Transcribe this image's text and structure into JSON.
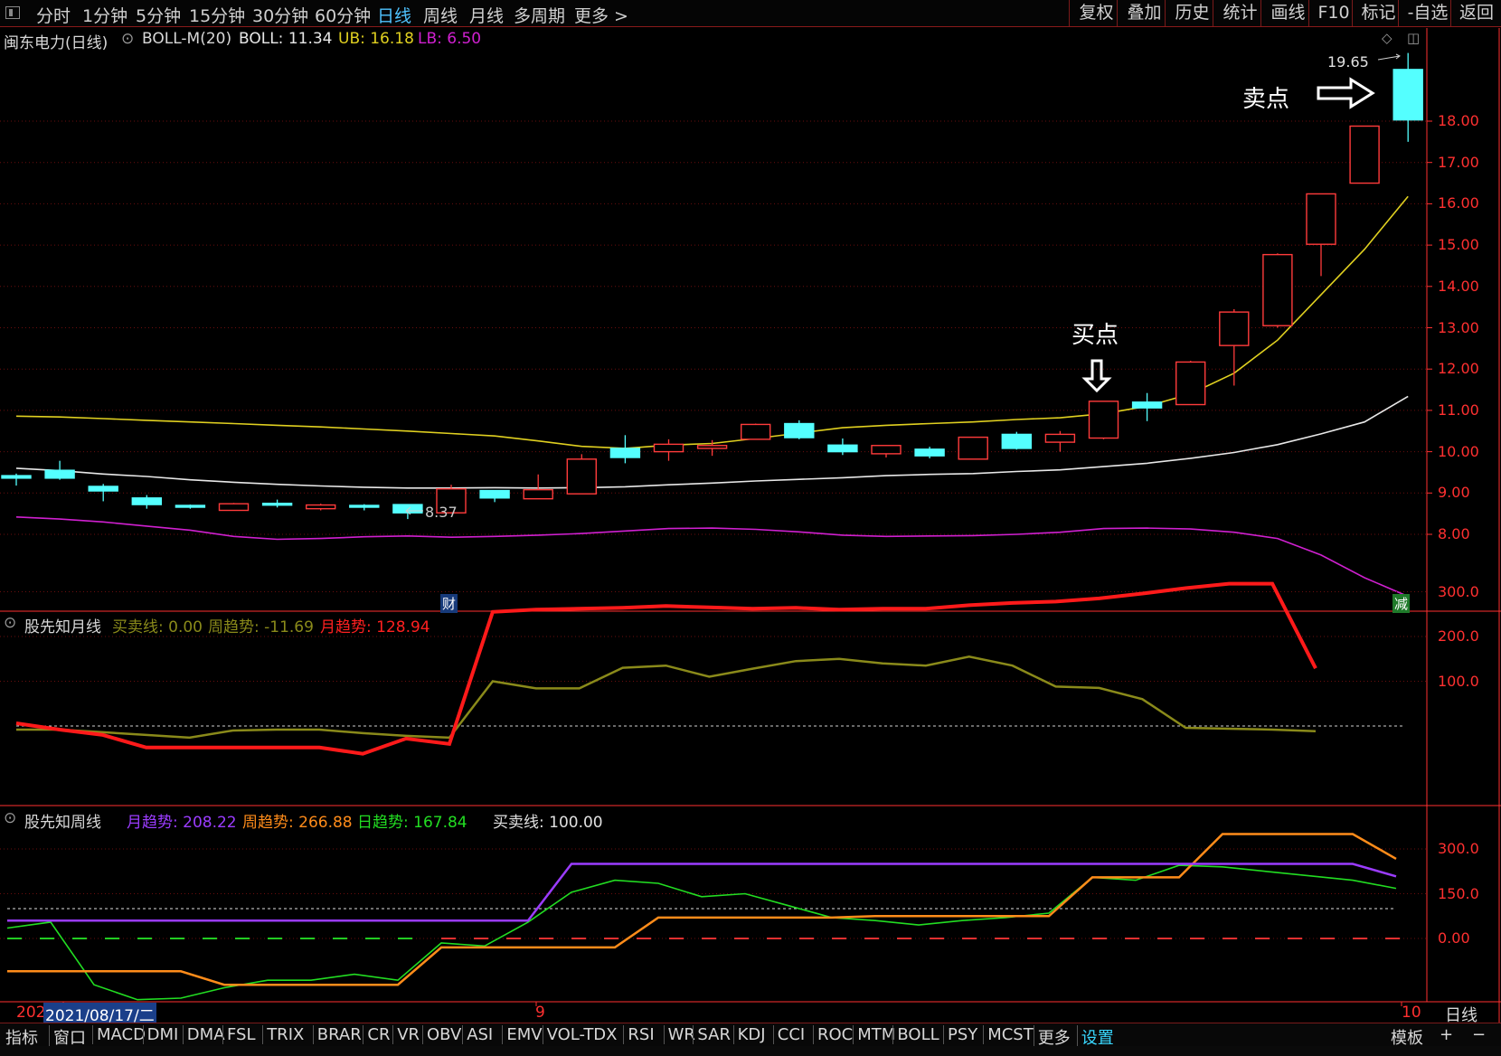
{
  "toolbar": {
    "timeframes": [
      "分时",
      "1分钟",
      "5分钟",
      "15分钟",
      "30分钟",
      "60分钟",
      "日线",
      "周线",
      "月线",
      "多周期",
      "更多 >"
    ],
    "active_timeframe": "日线",
    "tools": [
      "复权",
      "叠加",
      "历史",
      "统计",
      "画线",
      "F10",
      "标记",
      "-自选",
      "返回"
    ]
  },
  "main_panel": {
    "stock_name": "闽东电力(日线)",
    "indicator": "BOLL-M(20)",
    "boll_text": "BOLL: 11.34",
    "ub_text": "UB: 16.18",
    "lb_text": "LB: 6.50",
    "price_ticks": [
      "18.00",
      "17.00",
      "16.00",
      "15.00",
      "14.00",
      "13.00",
      "12.00",
      "11.00",
      "10.00",
      "9.00",
      "8.00"
    ],
    "high_marker": "19.65",
    "low_marker": "8.37",
    "badge_cai": "财",
    "badge_jian": "减",
    "annotation_sell": "卖点",
    "annotation_buy": "买点"
  },
  "panel2": {
    "title": "股先知月线",
    "items": [
      {
        "label": "买卖线: 0.00",
        "color": "#8a8a1a"
      },
      {
        "label": "周趋势: -11.69",
        "color": "#8a8a1a"
      },
      {
        "label": "月趋势: 128.94",
        "color": "#ff2020"
      }
    ],
    "ticks": [
      "300.0",
      "200.0",
      "100.0"
    ]
  },
  "panel3": {
    "title": "股先知周线",
    "items": [
      {
        "label": "月趋势: 208.22",
        "color": "#9b3cff"
      },
      {
        "label": "周趋势: 266.88",
        "color": "#ff8c1a"
      },
      {
        "label": "日趋势: 167.84",
        "color": "#22dd22"
      },
      {
        "label": "买卖线: 100.00",
        "color": "#e0e0e0"
      }
    ],
    "ticks": [
      "300.0",
      "150.0",
      "0.00"
    ]
  },
  "xaxis": {
    "start_label": "202",
    "date_label": "2021/08/17/二",
    "month_9": "9",
    "month_10": "10",
    "period": "日线"
  },
  "bottom_tabs": [
    "指标",
    "窗口",
    "MACD",
    "DMI",
    "DMA",
    "FSL",
    "TRIX",
    "BRAR",
    "CR",
    "VR",
    "OBV",
    "ASI",
    "EMV",
    "VOL-TDX",
    "RSI",
    "WR",
    "SAR",
    "KDJ",
    "CCI",
    "ROC",
    "MTM",
    "BOLL",
    "PSY",
    "MCST",
    "更多",
    "设置"
  ],
  "bottom_right": [
    "模板",
    "+",
    "−"
  ],
  "colors": {
    "up": "#ff3b3b",
    "down": "#54ffff",
    "ub": "#e0d020",
    "mid": "#e8e8e8",
    "lb": "#d020d0",
    "grid": "#6a0e0e",
    "axis": "#ff3030"
  },
  "chart_data": {
    "type": "candlestick",
    "candles": [
      {
        "o": 9.42,
        "h": 9.47,
        "l": 9.18,
        "c": 9.36
      },
      {
        "o": 9.55,
        "h": 9.78,
        "l": 9.32,
        "c": 9.36
      },
      {
        "o": 9.16,
        "h": 9.22,
        "l": 8.8,
        "c": 9.05
      },
      {
        "o": 8.88,
        "h": 8.95,
        "l": 8.62,
        "c": 8.72
      },
      {
        "o": 8.7,
        "h": 8.72,
        "l": 8.62,
        "c": 8.68
      },
      {
        "o": 8.58,
        "h": 8.76,
        "l": 8.58,
        "c": 8.74
      },
      {
        "o": 8.75,
        "h": 8.84,
        "l": 8.65,
        "c": 8.72
      },
      {
        "o": 8.62,
        "h": 8.74,
        "l": 8.58,
        "c": 8.71
      },
      {
        "o": 8.7,
        "h": 8.73,
        "l": 8.58,
        "c": 8.68
      },
      {
        "o": 8.72,
        "h": 8.72,
        "l": 8.37,
        "c": 8.52
      },
      {
        "o": 8.52,
        "h": 9.2,
        "l": 8.5,
        "c": 9.1
      },
      {
        "o": 9.06,
        "h": 9.06,
        "l": 8.78,
        "c": 8.88
      },
      {
        "o": 8.86,
        "h": 9.45,
        "l": 8.86,
        "c": 9.08
      },
      {
        "o": 8.98,
        "h": 9.94,
        "l": 8.98,
        "c": 9.82
      },
      {
        "o": 10.08,
        "h": 10.4,
        "l": 9.72,
        "c": 9.86
      },
      {
        "o": 10.0,
        "h": 10.3,
        "l": 9.78,
        "c": 10.18
      },
      {
        "o": 10.08,
        "h": 10.28,
        "l": 9.9,
        "c": 10.15
      },
      {
        "o": 10.3,
        "h": 10.68,
        "l": 10.3,
        "c": 10.66
      },
      {
        "o": 10.68,
        "h": 10.76,
        "l": 10.3,
        "c": 10.34
      },
      {
        "o": 10.16,
        "h": 10.32,
        "l": 9.92,
        "c": 10.0
      },
      {
        "o": 9.95,
        "h": 10.16,
        "l": 9.86,
        "c": 10.15
      },
      {
        "o": 10.06,
        "h": 10.12,
        "l": 9.84,
        "c": 9.9
      },
      {
        "o": 9.82,
        "h": 10.35,
        "l": 9.82,
        "c": 10.35
      },
      {
        "o": 10.42,
        "h": 10.48,
        "l": 10.05,
        "c": 10.08
      },
      {
        "o": 10.23,
        "h": 10.5,
        "l": 10.0,
        "c": 10.42
      },
      {
        "o": 10.33,
        "h": 11.22,
        "l": 10.3,
        "c": 11.22
      },
      {
        "o": 11.2,
        "h": 11.42,
        "l": 10.74,
        "c": 11.06
      },
      {
        "o": 11.14,
        "h": 12.2,
        "l": 11.14,
        "c": 12.17
      },
      {
        "o": 12.57,
        "h": 13.45,
        "l": 11.6,
        "c": 13.38
      },
      {
        "o": 13.05,
        "h": 14.8,
        "l": 13.0,
        "c": 14.77
      },
      {
        "o": 15.02,
        "h": 16.24,
        "l": 14.25,
        "c": 16.24
      },
      {
        "o": 16.5,
        "h": 17.88,
        "l": 16.5,
        "c": 17.88
      },
      {
        "o": 19.25,
        "h": 19.65,
        "l": 17.5,
        "c": 18.03
      }
    ],
    "boll_ub": [
      10.86,
      10.84,
      10.8,
      10.76,
      10.72,
      10.68,
      10.64,
      10.6,
      10.55,
      10.5,
      10.44,
      10.38,
      10.26,
      10.13,
      10.08,
      10.16,
      10.2,
      10.32,
      10.45,
      10.58,
      10.64,
      10.68,
      10.72,
      10.78,
      10.82,
      10.92,
      11.1,
      11.4,
      11.9,
      12.7,
      13.8,
      14.9,
      16.18
    ],
    "boll_mid": [
      9.6,
      9.54,
      9.46,
      9.4,
      9.32,
      9.26,
      9.21,
      9.17,
      9.14,
      9.12,
      9.12,
      9.13,
      9.12,
      9.13,
      9.15,
      9.2,
      9.24,
      9.29,
      9.33,
      9.37,
      9.42,
      9.45,
      9.47,
      9.52,
      9.56,
      9.64,
      9.72,
      9.84,
      9.98,
      10.17,
      10.43,
      10.72,
      11.34
    ],
    "boll_lb": [
      8.42,
      8.37,
      8.3,
      8.2,
      8.1,
      7.95,
      7.88,
      7.9,
      7.94,
      7.96,
      7.93,
      7.95,
      7.98,
      8.02,
      8.08,
      8.14,
      8.15,
      8.12,
      8.06,
      7.98,
      7.95,
      7.96,
      7.97,
      8.0,
      8.05,
      8.14,
      8.15,
      8.13,
      8.05,
      7.9,
      7.5,
      6.95,
      6.5
    ],
    "panel2_series": {
      "月趋势": [
        6,
        -8,
        -20,
        -48,
        -48,
        -48,
        -48,
        -48,
        -62,
        -28,
        -40,
        255,
        260,
        262,
        264,
        268,
        265,
        262,
        264,
        260,
        262,
        262,
        270,
        275,
        278,
        285,
        296,
        308,
        318,
        318,
        128.94
      ],
      "周趋势": [
        -8,
        -8,
        -14,
        -20,
        -26,
        -10,
        -8,
        -8,
        -16,
        -22,
        -26,
        100,
        84,
        84,
        130,
        135,
        110,
        128,
        145,
        150,
        140,
        135,
        155,
        135,
        88,
        85,
        60,
        -4,
        -6,
        -8,
        -11.69
      ],
      "买卖线": [
        0,
        0,
        0,
        0,
        0,
        0,
        0,
        0,
        0,
        0,
        0,
        0,
        0,
        0,
        0,
        0,
        0,
        0,
        0,
        0,
        0,
        0,
        0,
        0,
        0,
        0,
        0,
        0,
        0,
        0,
        0
      ]
    },
    "panel3_series": {
      "月趋势": [
        60,
        60,
        60,
        60,
        60,
        60,
        60,
        60,
        60,
        60,
        60,
        60,
        60,
        250,
        250,
        250,
        250,
        250,
        250,
        250,
        250,
        250,
        250,
        250,
        250,
        250,
        250,
        250,
        250,
        250,
        250,
        250,
        208.22
      ],
      "周趋势": [
        -110,
        -110,
        -110,
        -110,
        -110,
        -155,
        -155,
        -155,
        -155,
        -155,
        -30,
        -30,
        -30,
        -30,
        -30,
        70,
        70,
        70,
        70,
        70,
        75,
        75,
        75,
        75,
        75,
        205,
        205,
        205,
        350,
        350,
        350,
        350,
        266.88
      ],
      "日趋势": [
        35,
        55,
        -155,
        -205,
        -200,
        -165,
        -140,
        -140,
        -120,
        -140,
        -15,
        -25,
        55,
        155,
        195,
        185,
        140,
        150,
        110,
        70,
        60,
        45,
        60,
        70,
        85,
        205,
        195,
        245,
        240,
        225,
        210,
        195,
        167.84
      ],
      "买卖线": [
        100,
        100,
        100,
        100,
        100,
        100,
        100,
        100,
        100,
        100,
        100,
        100,
        100,
        100,
        100,
        100,
        100,
        100,
        100,
        100,
        100,
        100,
        100,
        100,
        100,
        100,
        100,
        100,
        100,
        100,
        100,
        100,
        100
      ]
    }
  }
}
